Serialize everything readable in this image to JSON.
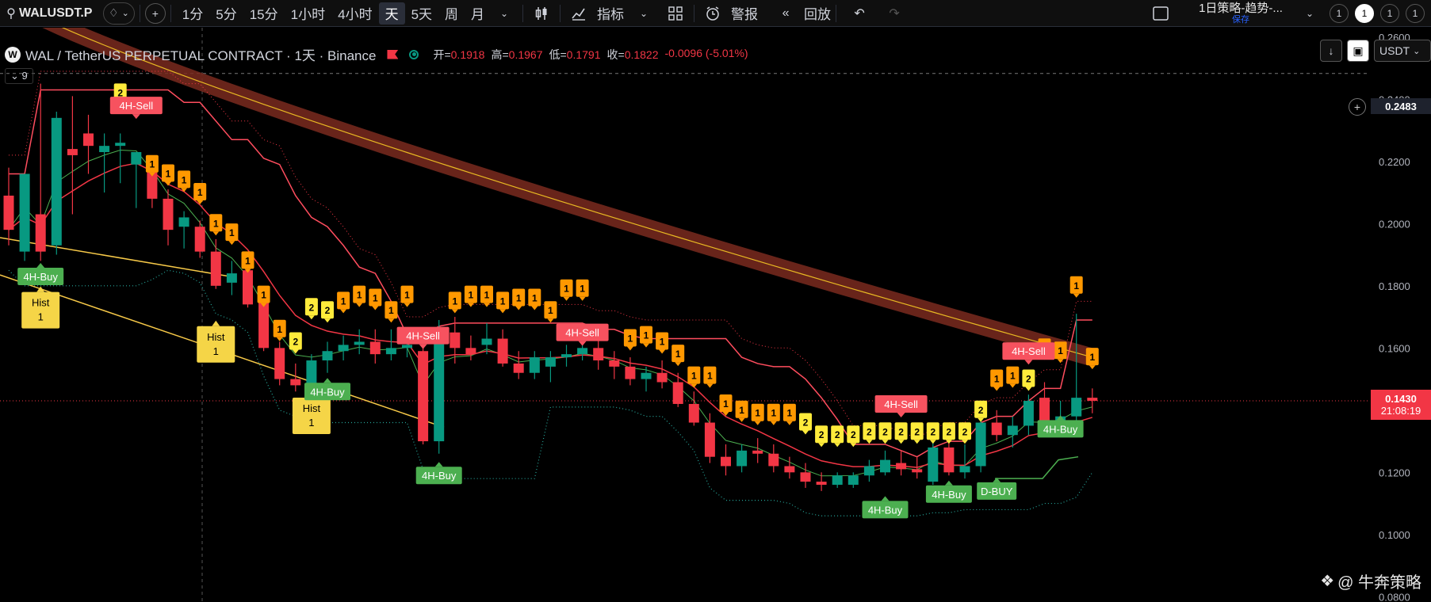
{
  "toolbar": {
    "symbol": "WALUSDT.P",
    "intervals": [
      "1分",
      "5分",
      "15分",
      "1小时",
      "4小时",
      "天",
      "5天",
      "周",
      "月"
    ],
    "active_interval": "天",
    "indicators_label": "指标",
    "alert_label": "警报",
    "replay_label": "回放",
    "layout_name": "1日策略-趋势-...",
    "layout_saved": "保存",
    "counter_values": [
      "1",
      "1",
      "1",
      "1"
    ]
  },
  "legend": {
    "title": "WAL / TetherUS PERPETUAL CONTRACT · 1天 · Binance",
    "open_label": "开=",
    "open": "0.1918",
    "high_label": "高=",
    "high": "0.1967",
    "low_label": "低=",
    "low": "0.1791",
    "close_label": "收=",
    "close": "0.1822",
    "change": "-0.0096 (-5.01%)",
    "indicator_count": "9"
  },
  "axis": {
    "currency": "USDT",
    "crosshair_price": "0.2483",
    "last_price": "0.1430",
    "countdown": "21:08:19"
  },
  "watermark": "@ 牛奔策略",
  "colors": {
    "up": "#089981",
    "down": "#f23645",
    "background": "#000000",
    "buy": "#4caf50",
    "sell": "#f7525f",
    "count_yellow": "#ffeb3b",
    "count_orange": "#ff9800"
  },
  "chart_data": {
    "type": "candlestick",
    "y_axis_labels": [
      "0.2600",
      "0.2400",
      "0.2200",
      "0.2000",
      "0.1800",
      "0.1600",
      "0.1400",
      "0.1200",
      "0.1000",
      "0.0800"
    ],
    "ylim": [
      0.0783,
      0.263
    ],
    "candles": [
      {
        "o": 0.209,
        "h": 0.218,
        "l": 0.193,
        "c": 0.198
      },
      {
        "o": 0.191,
        "h": 0.215,
        "l": 0.188,
        "c": 0.216
      },
      {
        "o": 0.203,
        "h": 0.245,
        "l": 0.188,
        "c": 0.191
      },
      {
        "o": 0.193,
        "h": 0.236,
        "l": 0.19,
        "c": 0.234
      },
      {
        "o": 0.224,
        "h": 0.241,
        "l": 0.203,
        "c": 0.222
      },
      {
        "o": 0.229,
        "h": 0.235,
        "l": 0.216,
        "c": 0.225
      },
      {
        "o": 0.223,
        "h": 0.229,
        "l": 0.21,
        "c": 0.225
      },
      {
        "o": 0.225,
        "h": 0.229,
        "l": 0.213,
        "c": 0.226
      },
      {
        "o": 0.219,
        "h": 0.223,
        "l": 0.205,
        "c": 0.223
      },
      {
        "o": 0.219,
        "h": 0.221,
        "l": 0.205,
        "c": 0.208
      },
      {
        "o": 0.208,
        "h": 0.211,
        "l": 0.193,
        "c": 0.198
      },
      {
        "o": 0.199,
        "h": 0.204,
        "l": 0.192,
        "c": 0.202
      },
      {
        "o": 0.199,
        "h": 0.201,
        "l": 0.189,
        "c": 0.191
      },
      {
        "o": 0.191,
        "h": 0.195,
        "l": 0.179,
        "c": 0.18
      },
      {
        "o": 0.181,
        "h": 0.188,
        "l": 0.177,
        "c": 0.184
      },
      {
        "o": 0.185,
        "h": 0.186,
        "l": 0.173,
        "c": 0.174
      },
      {
        "o": 0.175,
        "h": 0.177,
        "l": 0.159,
        "c": 0.16
      },
      {
        "o": 0.16,
        "h": 0.162,
        "l": 0.148,
        "c": 0.15
      },
      {
        "o": 0.15,
        "h": 0.155,
        "l": 0.146,
        "c": 0.148
      },
      {
        "o": 0.148,
        "h": 0.158,
        "l": 0.144,
        "c": 0.156
      },
      {
        "o": 0.156,
        "h": 0.162,
        "l": 0.152,
        "c": 0.159
      },
      {
        "o": 0.159,
        "h": 0.164,
        "l": 0.156,
        "c": 0.161
      },
      {
        "o": 0.161,
        "h": 0.166,
        "l": 0.158,
        "c": 0.162
      },
      {
        "o": 0.162,
        "h": 0.166,
        "l": 0.155,
        "c": 0.158
      },
      {
        "o": 0.158,
        "h": 0.166,
        "l": 0.156,
        "c": 0.16
      },
      {
        "o": 0.16,
        "h": 0.165,
        "l": 0.157,
        "c": 0.161
      },
      {
        "o": 0.159,
        "h": 0.163,
        "l": 0.129,
        "c": 0.13
      },
      {
        "o": 0.13,
        "h": 0.169,
        "l": 0.126,
        "c": 0.166
      },
      {
        "o": 0.165,
        "h": 0.17,
        "l": 0.155,
        "c": 0.16
      },
      {
        "o": 0.16,
        "h": 0.164,
        "l": 0.156,
        "c": 0.158
      },
      {
        "o": 0.161,
        "h": 0.168,
        "l": 0.158,
        "c": 0.163
      },
      {
        "o": 0.163,
        "h": 0.166,
        "l": 0.154,
        "c": 0.155
      },
      {
        "o": 0.155,
        "h": 0.159,
        "l": 0.15,
        "c": 0.152
      },
      {
        "o": 0.152,
        "h": 0.159,
        "l": 0.15,
        "c": 0.157
      },
      {
        "o": 0.154,
        "h": 0.159,
        "l": 0.149,
        "c": 0.157
      },
      {
        "o": 0.157,
        "h": 0.161,
        "l": 0.154,
        "c": 0.158
      },
      {
        "o": 0.158,
        "h": 0.162,
        "l": 0.156,
        "c": 0.16
      },
      {
        "o": 0.16,
        "h": 0.165,
        "l": 0.153,
        "c": 0.156
      },
      {
        "o": 0.156,
        "h": 0.159,
        "l": 0.15,
        "c": 0.154
      },
      {
        "o": 0.154,
        "h": 0.157,
        "l": 0.148,
        "c": 0.15
      },
      {
        "o": 0.15,
        "h": 0.154,
        "l": 0.146,
        "c": 0.152
      },
      {
        "o": 0.152,
        "h": 0.156,
        "l": 0.147,
        "c": 0.149
      },
      {
        "o": 0.149,
        "h": 0.152,
        "l": 0.141,
        "c": 0.142
      },
      {
        "o": 0.142,
        "h": 0.146,
        "l": 0.135,
        "c": 0.136
      },
      {
        "o": 0.136,
        "h": 0.139,
        "l": 0.123,
        "c": 0.125
      },
      {
        "o": 0.125,
        "h": 0.129,
        "l": 0.119,
        "c": 0.122
      },
      {
        "o": 0.122,
        "h": 0.129,
        "l": 0.12,
        "c": 0.127
      },
      {
        "o": 0.127,
        "h": 0.131,
        "l": 0.123,
        "c": 0.126
      },
      {
        "o": 0.126,
        "h": 0.129,
        "l": 0.12,
        "c": 0.122
      },
      {
        "o": 0.122,
        "h": 0.125,
        "l": 0.118,
        "c": 0.12
      },
      {
        "o": 0.12,
        "h": 0.123,
        "l": 0.115,
        "c": 0.117
      },
      {
        "o": 0.117,
        "h": 0.12,
        "l": 0.114,
        "c": 0.116
      },
      {
        "o": 0.116,
        "h": 0.12,
        "l": 0.115,
        "c": 0.119
      },
      {
        "o": 0.116,
        "h": 0.12,
        "l": 0.115,
        "c": 0.119
      },
      {
        "o": 0.119,
        "h": 0.124,
        "l": 0.117,
        "c": 0.122
      },
      {
        "o": 0.12,
        "h": 0.127,
        "l": 0.119,
        "c": 0.124
      },
      {
        "o": 0.123,
        "h": 0.127,
        "l": 0.119,
        "c": 0.121
      },
      {
        "o": 0.121,
        "h": 0.125,
        "l": 0.118,
        "c": 0.12
      },
      {
        "o": 0.117,
        "h": 0.13,
        "l": 0.116,
        "c": 0.128
      },
      {
        "o": 0.128,
        "h": 0.132,
        "l": 0.119,
        "c": 0.12
      },
      {
        "o": 0.12,
        "h": 0.129,
        "l": 0.118,
        "c": 0.122
      },
      {
        "o": 0.122,
        "h": 0.138,
        "l": 0.12,
        "c": 0.136
      },
      {
        "o": 0.136,
        "h": 0.14,
        "l": 0.13,
        "c": 0.132
      },
      {
        "o": 0.132,
        "h": 0.138,
        "l": 0.128,
        "c": 0.135
      },
      {
        "o": 0.135,
        "h": 0.145,
        "l": 0.132,
        "c": 0.143
      },
      {
        "o": 0.144,
        "h": 0.149,
        "l": 0.133,
        "c": 0.136
      },
      {
        "o": 0.136,
        "h": 0.143,
        "l": 0.132,
        "c": 0.138
      },
      {
        "o": 0.138,
        "h": 0.171,
        "l": 0.134,
        "c": 0.144
      },
      {
        "o": 0.144,
        "h": 0.147,
        "l": 0.139,
        "c": 0.143
      }
    ],
    "signals": [
      {
        "label": "4H-Buy",
        "type": "buy",
        "i": 2,
        "price": 0.183
      },
      {
        "label": "4H-Sell",
        "type": "sell",
        "i": 8,
        "price": 0.238
      },
      {
        "label": "4H-Buy",
        "type": "buy",
        "i": 20,
        "price": 0.146
      },
      {
        "label": "4H-Sell",
        "type": "sell",
        "i": 26,
        "price": 0.164
      },
      {
        "label": "4H-Buy",
        "type": "buy",
        "i": 27,
        "price": 0.119
      },
      {
        "label": "4H-Sell",
        "type": "sell",
        "i": 36,
        "price": 0.165
      },
      {
        "label": "4H-Buy",
        "type": "buy",
        "i": 55,
        "price": 0.108
      },
      {
        "label": "4H-Sell",
        "type": "sell",
        "i": 56,
        "price": 0.142
      },
      {
        "label": "4H-Buy",
        "type": "buy",
        "i": 59,
        "price": 0.113
      },
      {
        "label": "D-BUY",
        "type": "buy",
        "i": 62,
        "price": 0.114
      },
      {
        "label": "4H-Sell",
        "type": "sell",
        "i": 64,
        "price": 0.159
      },
      {
        "label": "4H-Buy",
        "type": "buy",
        "i": 66,
        "price": 0.134
      }
    ],
    "hist_labels": [
      {
        "line1": "Hist",
        "line2": "1",
        "i": 2,
        "price": 0.177
      },
      {
        "line1": "Hist",
        "line2": "1",
        "i": 13,
        "price": 0.166
      },
      {
        "line1": "Hist",
        "line2": "1",
        "i": 19,
        "price": 0.143
      }
    ],
    "count_labels": [
      {
        "n": "2",
        "i": 7,
        "price": 0.242,
        "color": "yellow"
      },
      {
        "n": "1",
        "i": 9,
        "price": 0.219,
        "color": "orange"
      },
      {
        "n": "1",
        "i": 10,
        "price": 0.216,
        "color": "orange"
      },
      {
        "n": "1",
        "i": 11,
        "price": 0.214,
        "color": "orange"
      },
      {
        "n": "1",
        "i": 12,
        "price": 0.21,
        "color": "orange"
      },
      {
        "n": "1",
        "i": 13,
        "price": 0.2,
        "color": "orange"
      },
      {
        "n": "1",
        "i": 14,
        "price": 0.197,
        "color": "orange"
      },
      {
        "n": "1",
        "i": 15,
        "price": 0.188,
        "color": "orange"
      },
      {
        "n": "1",
        "i": 16,
        "price": 0.177,
        "color": "orange"
      },
      {
        "n": "1",
        "i": 17,
        "price": 0.166,
        "color": "orange"
      },
      {
        "n": "2",
        "i": 18,
        "price": 0.162,
        "color": "yellow"
      },
      {
        "n": "2",
        "i": 19,
        "price": 0.173,
        "color": "yellow"
      },
      {
        "n": "2",
        "i": 20,
        "price": 0.172,
        "color": "yellow"
      },
      {
        "n": "1",
        "i": 21,
        "price": 0.175,
        "color": "orange"
      },
      {
        "n": "1",
        "i": 22,
        "price": 0.177,
        "color": "orange"
      },
      {
        "n": "1",
        "i": 23,
        "price": 0.176,
        "color": "orange"
      },
      {
        "n": "1",
        "i": 24,
        "price": 0.172,
        "color": "orange"
      },
      {
        "n": "1",
        "i": 25,
        "price": 0.177,
        "color": "orange"
      },
      {
        "n": "1",
        "i": 28,
        "price": 0.175,
        "color": "orange"
      },
      {
        "n": "1",
        "i": 29,
        "price": 0.177,
        "color": "orange"
      },
      {
        "n": "1",
        "i": 30,
        "price": 0.177,
        "color": "orange"
      },
      {
        "n": "1",
        "i": 31,
        "price": 0.175,
        "color": "orange"
      },
      {
        "n": "1",
        "i": 32,
        "price": 0.176,
        "color": "orange"
      },
      {
        "n": "1",
        "i": 33,
        "price": 0.176,
        "color": "orange"
      },
      {
        "n": "1",
        "i": 34,
        "price": 0.172,
        "color": "orange"
      },
      {
        "n": "1",
        "i": 35,
        "price": 0.179,
        "color": "orange"
      },
      {
        "n": "1",
        "i": 36,
        "price": 0.179,
        "color": "orange"
      },
      {
        "n": "1",
        "i": 39,
        "price": 0.163,
        "color": "orange"
      },
      {
        "n": "1",
        "i": 40,
        "price": 0.164,
        "color": "orange"
      },
      {
        "n": "1",
        "i": 41,
        "price": 0.162,
        "color": "orange"
      },
      {
        "n": "1",
        "i": 42,
        "price": 0.158,
        "color": "orange"
      },
      {
        "n": "1",
        "i": 43,
        "price": 0.151,
        "color": "orange"
      },
      {
        "n": "1",
        "i": 44,
        "price": 0.151,
        "color": "orange"
      },
      {
        "n": "1",
        "i": 45,
        "price": 0.142,
        "color": "orange"
      },
      {
        "n": "1",
        "i": 46,
        "price": 0.14,
        "color": "orange"
      },
      {
        "n": "1",
        "i": 47,
        "price": 0.139,
        "color": "orange"
      },
      {
        "n": "1",
        "i": 48,
        "price": 0.139,
        "color": "orange"
      },
      {
        "n": "1",
        "i": 49,
        "price": 0.139,
        "color": "orange"
      },
      {
        "n": "2",
        "i": 50,
        "price": 0.136,
        "color": "yellow"
      },
      {
        "n": "2",
        "i": 51,
        "price": 0.132,
        "color": "yellow"
      },
      {
        "n": "2",
        "i": 52,
        "price": 0.132,
        "color": "yellow"
      },
      {
        "n": "2",
        "i": 53,
        "price": 0.132,
        "color": "yellow"
      },
      {
        "n": "2",
        "i": 54,
        "price": 0.133,
        "color": "yellow"
      },
      {
        "n": "2",
        "i": 55,
        "price": 0.133,
        "color": "yellow"
      },
      {
        "n": "2",
        "i": 56,
        "price": 0.133,
        "color": "yellow"
      },
      {
        "n": "2",
        "i": 57,
        "price": 0.133,
        "color": "yellow"
      },
      {
        "n": "2",
        "i": 58,
        "price": 0.133,
        "color": "yellow"
      },
      {
        "n": "2",
        "i": 59,
        "price": 0.133,
        "color": "yellow"
      },
      {
        "n": "2",
        "i": 60,
        "price": 0.133,
        "color": "yellow"
      },
      {
        "n": "2",
        "i": 61,
        "price": 0.14,
        "color": "yellow"
      },
      {
        "n": "1",
        "i": 62,
        "price": 0.15,
        "color": "orange"
      },
      {
        "n": "1",
        "i": 63,
        "price": 0.151,
        "color": "orange"
      },
      {
        "n": "2",
        "i": 64,
        "price": 0.15,
        "color": "yellow"
      },
      {
        "n": "1",
        "i": 65,
        "price": 0.16,
        "color": "orange"
      },
      {
        "n": "1",
        "i": 66,
        "price": 0.159,
        "color": "orange"
      },
      {
        "n": "1",
        "i": 67,
        "price": 0.18,
        "color": "orange"
      },
      {
        "n": "1",
        "i": 68,
        "price": 0.157,
        "color": "orange"
      }
    ]
  }
}
